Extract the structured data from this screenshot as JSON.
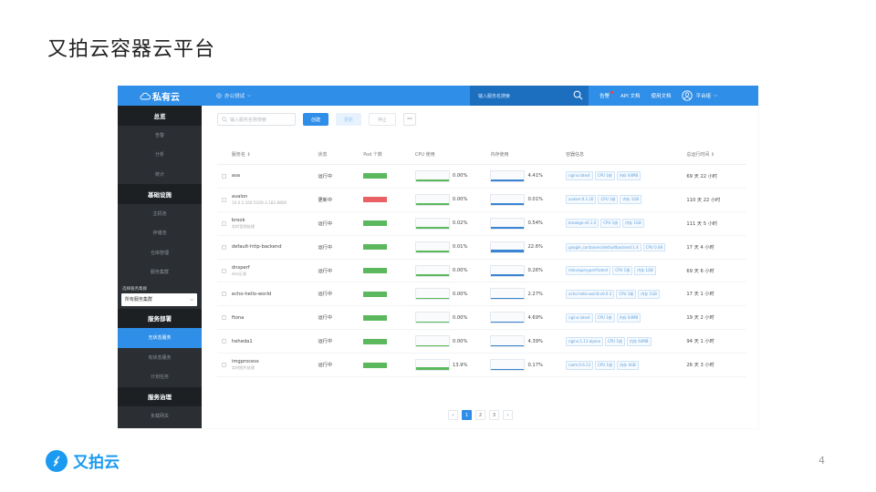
{
  "slide": {
    "title": "又拍云容器云平台",
    "page_number": "4",
    "brand_name": "又拍云",
    "brand_color": "#1a9af0"
  },
  "app": {
    "logo_text": "私有云",
    "environment": "办公测试",
    "search_placeholder": "输入服务名搜索",
    "links": {
      "alerts": "告警",
      "api_docs": "API 文档",
      "user_docs": "使用文档"
    },
    "user_label": "平台组",
    "accent_color": "#2f8ee8"
  },
  "sidebar": {
    "overview": "总览",
    "overview_items": [
      "告警",
      "分析",
      "统计"
    ],
    "infra": "基础设施",
    "infra_items": [
      "主机池",
      "存储池",
      "仓库管理",
      "服务集群"
    ],
    "select_label": "选择服务集群",
    "select_value": "所有服务集群",
    "deploy": "服务部署",
    "deploy_items": [
      "无状态服务",
      "有状态服务",
      "计划任务"
    ],
    "governance": "服务治理",
    "governance_items": [
      "负载网关"
    ]
  },
  "toolbar": {
    "search_placeholder": "输入服务名称搜索",
    "create": "创建",
    "update": "更新",
    "stop": "停止",
    "more": "···"
  },
  "table": {
    "headers": {
      "name": "服务名",
      "state": "状态",
      "pods": "Pod 个数",
      "cpu": "CPU 使用",
      "mem": "内存使用",
      "info": "容器信息",
      "uptime": "总运行时间"
    },
    "rows": [
      {
        "name": "asa",
        "sub": "",
        "state": "运行中",
        "pod_ok": true,
        "cpu": "0.00%",
        "cpu_frac": 0.0,
        "mem": "4.41%",
        "mem_frac": 0.0441,
        "tags": [
          "nginx:latest",
          "CPU 1核",
          "内存 64MB"
        ],
        "uptime": "69 天 22 小时"
      },
      {
        "name": "avalon",
        "sub": "10.0.5.160:5100-3.181:8800",
        "state": "更新中",
        "pod_ok": false,
        "cpu": "0.00%",
        "cpu_frac": 0.0,
        "mem": "0.01%",
        "mem_frac": 0.0001,
        "tags": [
          "avalon:0.1.20",
          "CPU 1核",
          "内存 1GB"
        ],
        "uptime": "110 天 22 小时"
      },
      {
        "name": "brook",
        "sub": "实时音频处理",
        "state": "运行中",
        "pod_ok": true,
        "cpu": "0.02%",
        "cpu_frac": 0.0002,
        "mem": "0.54%",
        "mem_frac": 0.0054,
        "tags": [
          "brookgo:v0.1.0",
          "CPU 1核",
          "内存 1GB"
        ],
        "uptime": "111 天 5 小时"
      },
      {
        "name": "default-http-backend",
        "sub": "",
        "state": "运行中",
        "pod_ok": true,
        "cpu": "0.01%",
        "cpu_frac": 0.0001,
        "mem": "22.6%",
        "mem_frac": 0.226,
        "tags": [
          "google_containers/defaultbackend:1.4",
          "CPU 0.08"
        ],
        "uptime": "17 天 4 小时"
      },
      {
        "name": "dnsperf",
        "sub": "dns压测",
        "state": "运行中",
        "pod_ok": true,
        "cpu": "0.00%",
        "cpu_frac": 0.0,
        "mem": "0.26%",
        "mem_frac": 0.0026,
        "tags": [
          "mlev/queryperf:latest",
          "CPU 1核",
          "内存 1GB"
        ],
        "uptime": "69 天 6 小时"
      },
      {
        "name": "echo-hello-world",
        "sub": "",
        "state": "运行中",
        "pod_ok": true,
        "cpu": "0.00%",
        "cpu_frac": 0.0,
        "mem": "2.27%",
        "mem_frac": 0.0227,
        "tags": [
          "echo-hello-world:v0.0.3",
          "CPU 1核",
          "内存 1GB"
        ],
        "uptime": "17 天 1 小时"
      },
      {
        "name": "ftona",
        "sub": "",
        "state": "运行中",
        "pod_ok": true,
        "cpu": "0.00%",
        "cpu_frac": 0.0,
        "mem": "4.69%",
        "mem_frac": 0.0469,
        "tags": [
          "nginx:latest",
          "CPU 1核",
          "内存 64MB"
        ],
        "uptime": "19 天 2 小时"
      },
      {
        "name": "heheda1",
        "sub": "",
        "state": "运行中",
        "pod_ok": true,
        "cpu": "0.00%",
        "cpu_frac": 0.0,
        "mem": "4.39%",
        "mem_frac": 0.0439,
        "tags": [
          "nginx:1.11-alpine",
          "CPU 1核",
          "内存 64MB"
        ],
        "uptime": "94 天 1 小时"
      },
      {
        "name": "imgprocess",
        "sub": "实时图片处理",
        "state": "运行中",
        "pod_ok": true,
        "cpu": "13.9%",
        "cpu_frac": 0.139,
        "mem": "0.17%",
        "mem_frac": 0.0017,
        "tags": [
          "nami:0.6.13",
          "CPU 1核",
          "内存 4GB"
        ],
        "uptime": "26 天 3 小时"
      }
    ]
  },
  "pagination": {
    "prev": "‹",
    "pages": [
      "1",
      "2",
      "3"
    ],
    "next": "›",
    "current": "1"
  }
}
